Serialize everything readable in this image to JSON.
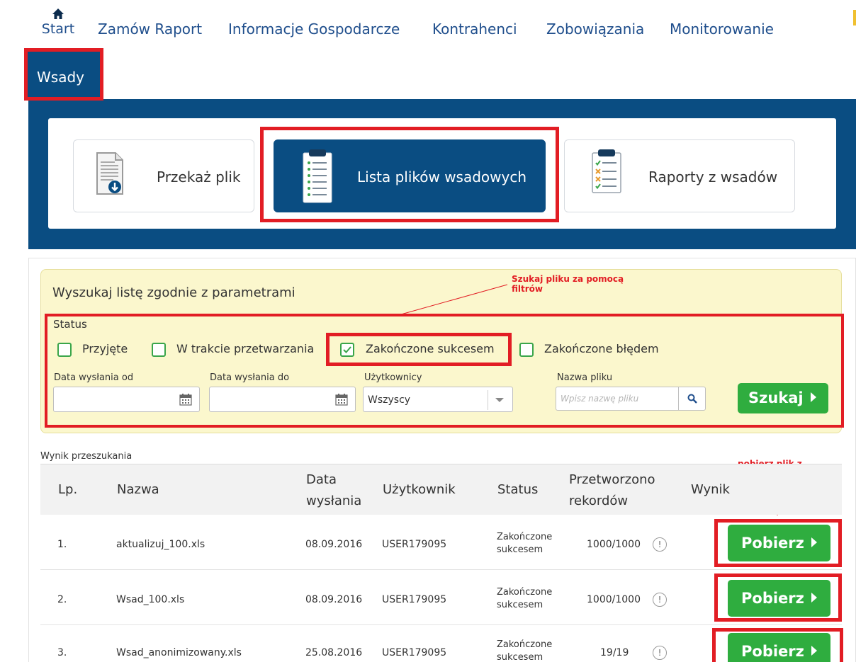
{
  "nav": {
    "home_label": "Start",
    "items": [
      "Zamów Raport",
      "Informacje Gospodarcze",
      "Kontrahenci",
      "Zobowiązania",
      "Monitorowanie"
    ],
    "wsady_label": "Wsady"
  },
  "tiles": [
    {
      "label": "Przekaż plik",
      "icon": "file-upload-icon",
      "active": false
    },
    {
      "label": "Lista plików wsadowych",
      "icon": "clipboard-list-icon",
      "active": true
    },
    {
      "label": "Raporty z wsadów",
      "icon": "clipboard-check-icon",
      "active": false
    }
  ],
  "filter": {
    "title": "Wyszukaj listę zgodnie z parametrami",
    "annotation": "Szukaj pliku za pomocą filtrów",
    "status_label": "Status",
    "checkboxes": [
      {
        "label": "Przyjęte",
        "checked": false
      },
      {
        "label": "W trakcie przetwarzania",
        "checked": false
      },
      {
        "label": "Zakończone sukcesem",
        "checked": true
      },
      {
        "label": "Zakończone błędem",
        "checked": false
      }
    ],
    "date_from_label": "Data wysłania od",
    "date_to_label": "Data wysłania do",
    "users_label": "Użytkownicy",
    "users_value": "Wszyscy",
    "filename_label": "Nazwa pliku",
    "filename_placeholder": "Wpisz nazwę pliku",
    "search_button": "Szukaj"
  },
  "results": {
    "label": "Wynik przeszukania",
    "annotation": "pobierz plik z odpowiedziami",
    "headers": {
      "lp": "Lp.",
      "name": "Nazwa",
      "date_line1": "Data",
      "date_line2": "wysłania",
      "user": "Użytkownik",
      "status": "Status",
      "processed_line1": "Przetworzono",
      "processed_line2": "rekordów",
      "result": "Wynik"
    },
    "rows": [
      {
        "lp": "1.",
        "name": "aktualizuj_100.xls",
        "date": "08.09.2016",
        "user": "USER179095",
        "status_line1": "Zakończone",
        "status_line2": "sukcesem",
        "processed": "1000/1000",
        "button": "Pobierz"
      },
      {
        "lp": "2.",
        "name": "Wsad_100.xls",
        "date": "08.09.2016",
        "user": "USER179095",
        "status_line1": "Zakończone",
        "status_line2": "sukcesem",
        "processed": "1000/1000",
        "button": "Pobierz"
      },
      {
        "lp": "3.",
        "name": "Wsad_anonimizowany.xls",
        "date": "25.08.2016",
        "user": "USER179095",
        "status_line1": "Zakończone",
        "status_line2": "sukcesem",
        "processed": "19/19",
        "button": "Pobierz"
      }
    ]
  },
  "colors": {
    "brand_blue": "#0a4d82",
    "highlight_red": "#e21d24",
    "button_green": "#2fad3f",
    "filter_bg": "#fbf7cd"
  }
}
